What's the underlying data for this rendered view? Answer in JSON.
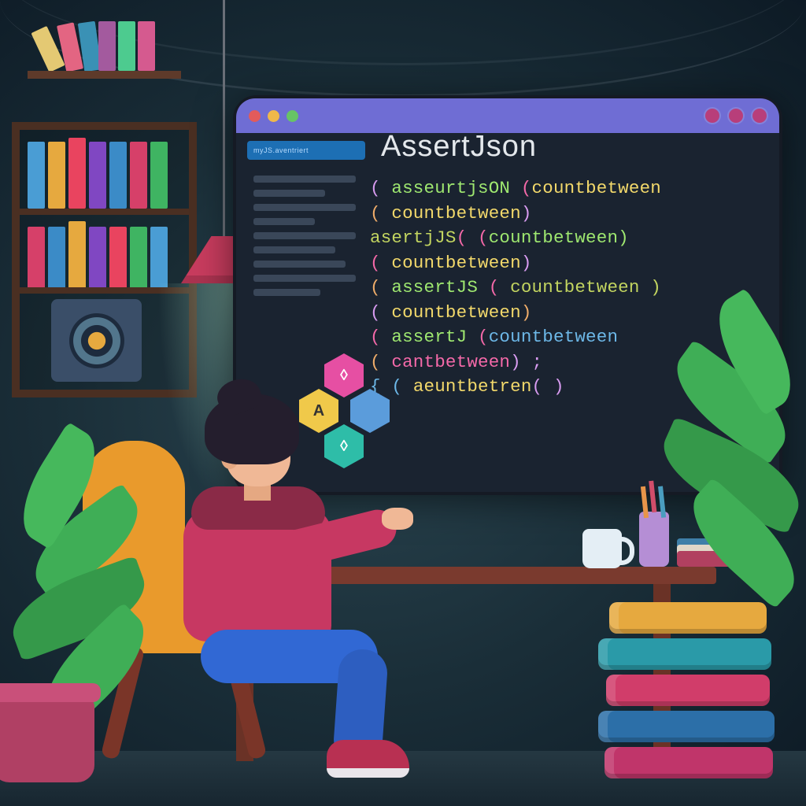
{
  "window": {
    "title": "AssertJson",
    "tab_label": "myJS.aventriert"
  },
  "code_lines": [
    {
      "a": "( ",
      "b": "asseurtjsON ",
      "c": "(",
      "d": "countbetween"
    },
    {
      "a": " ( ",
      "b": "countbetween",
      "c": ")",
      "d": ""
    },
    {
      "a": "  ",
      "b": "asertjJS",
      "c": "( (",
      "d": "countbetween)"
    },
    {
      "a": "( ",
      "b": "countbetween",
      "c": ")",
      "d": ""
    },
    {
      "a": " ( ",
      "b": "assertJS",
      "c": " ( ",
      "d": "countbetween )"
    },
    {
      "a": "  ( ",
      "b": "countbetween",
      "c": ")",
      "d": ""
    },
    {
      "a": "( ",
      "b": "assertJ ",
      "c": "(",
      "d": "countbetween"
    },
    {
      "a": " ( ",
      "b": "cantbetween",
      "c": ") ;",
      "d": ""
    },
    {
      "a": "{ ( ",
      "b": "aeuntbetren",
      "c": "( )",
      "d": ""
    }
  ],
  "hex_labels": {
    "top": "◊",
    "left": "A",
    "right": "",
    "bottom": "◊"
  }
}
